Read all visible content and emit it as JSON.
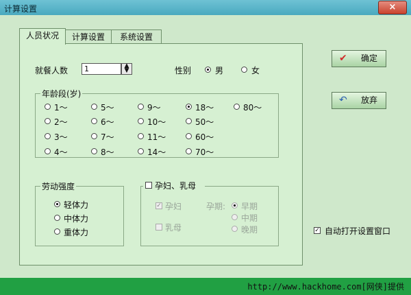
{
  "window": {
    "title": "计算设置",
    "close": "×"
  },
  "tabs": [
    {
      "label": "人员状况",
      "active": true
    },
    {
      "label": "计算设置",
      "active": false
    },
    {
      "label": "系统设置",
      "active": false
    }
  ],
  "people": {
    "label": "就餐人数",
    "value": "1",
    "spin_icon": "spinner-icon"
  },
  "gender": {
    "label": "性别",
    "male": "男",
    "female": "女",
    "selected": "男"
  },
  "age_group": {
    "label": "年龄段(岁)",
    "options": [
      "1～",
      "5～",
      "9～",
      "18～",
      "80～",
      "2～",
      "6～",
      "10～",
      "50～",
      "3～",
      "7～",
      "11～",
      "60～",
      "4～",
      "8～",
      "14～",
      "70～"
    ],
    "selected": "18～"
  },
  "labor": {
    "label": "劳动强度",
    "options": [
      "轻体力",
      "中体力",
      "重体力"
    ],
    "selected": "轻体力"
  },
  "pregnancy": {
    "label": "孕妇、乳母",
    "pregnant": "孕妇",
    "lactating": "乳母",
    "period_label": "孕期:",
    "periods": [
      "早期",
      "中期",
      "晚期"
    ],
    "selected_period": "早期"
  },
  "buttons": {
    "ok": "确定",
    "cancel": "放弃"
  },
  "auto_open": {
    "label": "自动打开设置窗口",
    "checked": true
  },
  "status": {
    "url": "http://www.hackhome.com[网侠]提供"
  },
  "colors": {
    "titlebar": "#4aa9bf",
    "background": "#cfe8cb",
    "statusbar": "#21a043",
    "close": "#c9432e"
  }
}
